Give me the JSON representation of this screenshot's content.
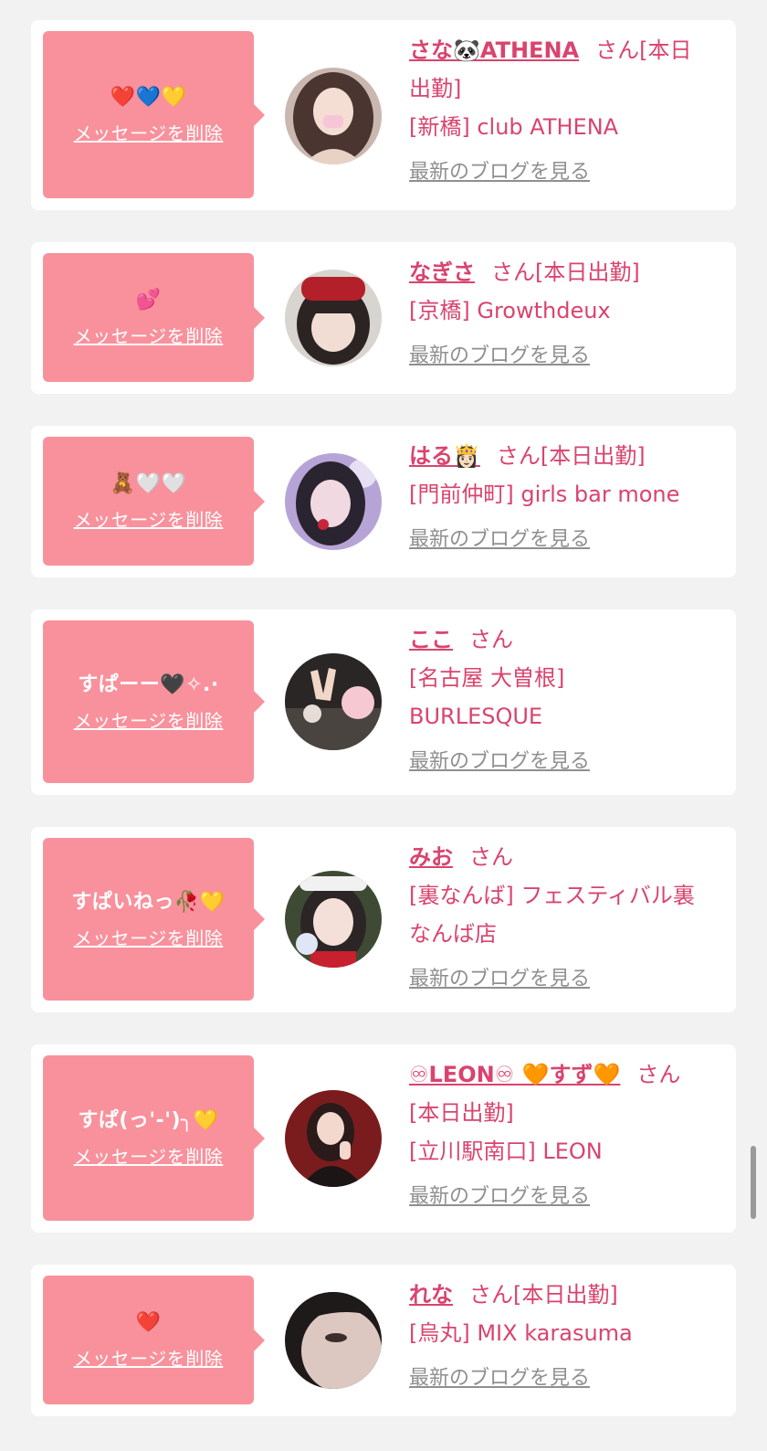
{
  "colors": {
    "background": "#f2f2f2",
    "card": "#ffffff",
    "bubble": "#f8919c",
    "accent_pink": "#d9446e",
    "link_gray": "#8f8f8f"
  },
  "labels": {
    "delete_message": "メッセージを削除",
    "view_blog": "最新のブログを見る",
    "honorific": "さん"
  },
  "entries": [
    {
      "message": "❤️💙💛",
      "name": "さな🐼ATHENA",
      "status": "[本日出勤]",
      "shop": "[新橋] club ATHENA",
      "avatar": "photo-girl-long-hair-icon"
    },
    {
      "message": "💕",
      "name": "なぎさ",
      "status": "[本日出勤]",
      "shop": "[京橋] Growthdeux",
      "avatar": "photo-girl-bow-icon"
    },
    {
      "message": "🧸🤍🤍",
      "name": "はる👸🏻",
      "status": "[本日出勤]",
      "shop": "[門前仲町] girls bar mone",
      "avatar": "photo-girl-purple-light-icon"
    },
    {
      "message": "すぱーー🖤✧.·",
      "name": "ここ",
      "status": "",
      "shop": "[名古屋 大曽根] BURLESQUE",
      "avatar": "photo-hand-peace-icon"
    },
    {
      "message": "すぱいねっ🥀💛",
      "name": "みお",
      "status": "",
      "shop": "[裏なんば] フェスティバル裏なんば店",
      "avatar": "photo-girl-bunny-ears-icon"
    },
    {
      "message": "すぱ(っ'-')╮💛",
      "name": "♾LEON♾ 🧡すず🧡",
      "status": "[本日出勤]",
      "shop": "[立川駅南口] LEON",
      "avatar": "photo-girl-red-background-icon"
    },
    {
      "message": "❤️",
      "name": "れな",
      "status": "[本日出勤]",
      "shop": "[烏丸] MIX karasuma",
      "avatar": "photo-face-closeup-icon"
    }
  ]
}
